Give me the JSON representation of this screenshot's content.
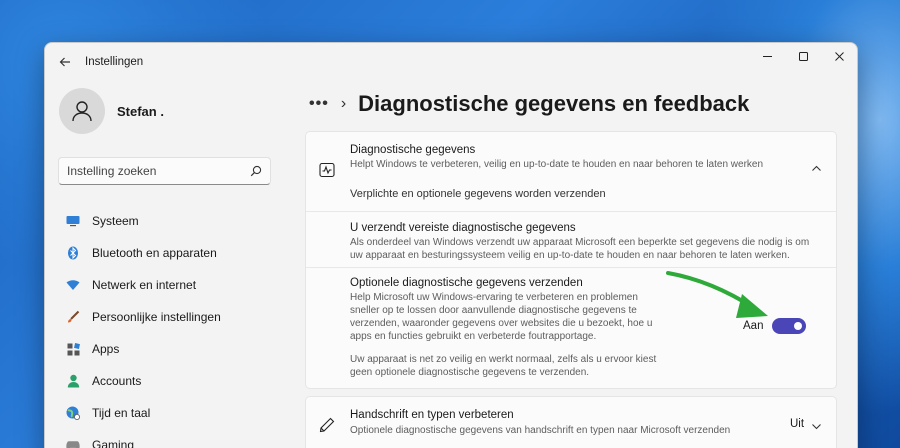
{
  "app": {
    "title": "Instellingen"
  },
  "user": {
    "name": "Stefan ."
  },
  "search": {
    "placeholder": "Instelling zoeken"
  },
  "sidebar": {
    "items": [
      {
        "label": "Systeem",
        "icon": "monitor-icon"
      },
      {
        "label": "Bluetooth en apparaten",
        "icon": "bluetooth-icon"
      },
      {
        "label": "Netwerk en internet",
        "icon": "wifi-icon"
      },
      {
        "label": "Persoonlijke instellingen",
        "icon": "brush-icon"
      },
      {
        "label": "Apps",
        "icon": "apps-icon"
      },
      {
        "label": "Accounts",
        "icon": "person-icon"
      },
      {
        "label": "Tijd en taal",
        "icon": "globe-clock-icon"
      },
      {
        "label": "Gaming",
        "icon": "gamepad-icon"
      }
    ]
  },
  "page": {
    "breadcrumb_dots": "•••",
    "title": "Diagnostische gegevens en feedback"
  },
  "diagnostics": {
    "title": "Diagnostische gegevens",
    "subtitle": "Helpt Windows te verbeteren, veilig en up-to-date te houden en naar behoren te laten werken",
    "status": "Verplichte en optionele gegevens worden verzenden",
    "required_title": "U verzendt vereiste diagnostische gegevens",
    "required_line1": "Als onderdeel van Windows verzendt uw apparaat Microsoft een beperkte set gegevens die nodig is om",
    "required_line2": "uw apparaat en besturingssysteem veilig en up-to-date te houden en naar behoren te laten werken.",
    "optional_title": "Optionele diagnostische gegevens verzenden",
    "optional_line1": "Help Microsoft uw Windows-ervaring te verbeteren en problemen",
    "optional_line2": "sneller op te lossen door aanvullende diagnostische gegevens te",
    "optional_line3": "verzenden, waaronder gegevens over websites die u bezoekt, hoe u",
    "optional_line4": "apps en functies gebruikt en verbeterde foutrapportage.",
    "optional_note1": "Uw apparaat is net zo veilig en werkt normaal, zelfs als u ervoor kiest",
    "optional_note2": "geen optionele diagnostische gegevens te verzenden.",
    "toggle_label": "Aan",
    "toggle_on": true
  },
  "handwriting": {
    "title": "Handschrift en typen verbeteren",
    "subtitle": "Optionele diagnostische gegevens van handschrift en typen naar Microsoft verzenden",
    "value": "Uit"
  },
  "colors": {
    "accent": "#4b46b8",
    "arrow": "#2eaa3a"
  }
}
